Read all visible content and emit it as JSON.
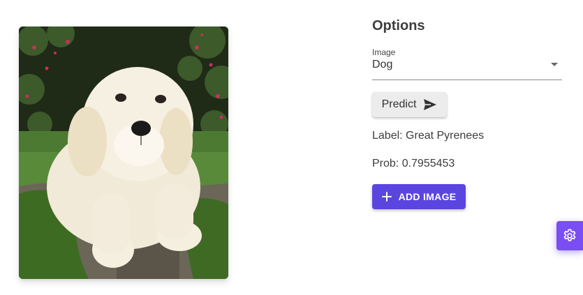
{
  "image": {
    "subject": "white puppy on mossy rock"
  },
  "options": {
    "title": "Options",
    "image_select": {
      "label": "Image",
      "value": "Dog"
    },
    "predict_label": "Predict",
    "result": {
      "label_text": "Label: Great Pyrenees",
      "prob_text": "Prob: 0.7955453"
    },
    "add_image_label": "ADD IMAGE"
  },
  "icons": {
    "predict": "send-icon",
    "add": "plus-icon",
    "settings": "gear-icon"
  },
  "colors": {
    "accent": "#5b45e0",
    "settings_tab": "#7b4df5",
    "predict_button": "#ececec"
  }
}
